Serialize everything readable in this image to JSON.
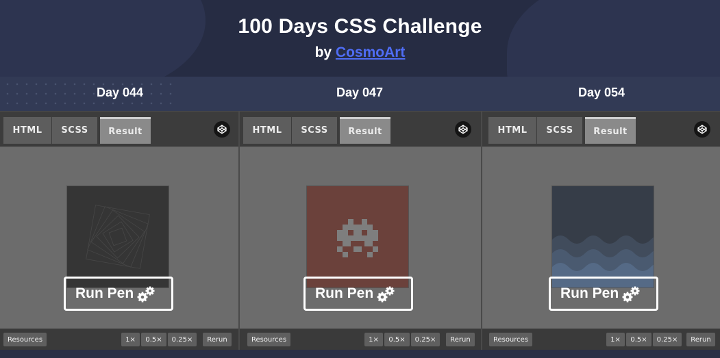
{
  "header": {
    "title": "100 Days CSS Challenge",
    "by_prefix": "by",
    "author": "CosmoArt"
  },
  "pens": [
    {
      "day": "Day 044",
      "tabs": [
        "HTML",
        "SCSS",
        "Result"
      ],
      "active_tab": "Result",
      "run_label": "Run Pen",
      "bottom": [
        "Resources",
        "1×",
        "0.5×",
        "0.25×",
        "Rerun"
      ]
    },
    {
      "day": "Day 047",
      "tabs": [
        "HTML",
        "SCSS",
        "Result"
      ],
      "active_tab": "Result",
      "run_label": "Run Pen",
      "bottom": [
        "Resources",
        "1×",
        "0.5×",
        "0.25×",
        "Rerun"
      ]
    },
    {
      "day": "Day 054",
      "tabs": [
        "HTML",
        "SCSS",
        "Result"
      ],
      "active_tab": "Result",
      "run_label": "Run Pen",
      "bottom": [
        "Resources",
        "1×",
        "0.5×",
        "0.25×",
        "Rerun"
      ]
    }
  ],
  "colors": {
    "header_bg": "#262c43",
    "strip_bg": "#323a55",
    "author_link": "#4f6df5",
    "pen_bg": "#6c6c6c",
    "day44_preview": "#353535",
    "day47_preview": "#6b413b",
    "day54_preview": "#363d48"
  },
  "icons": [
    "codepen-icon",
    "gears-icon"
  ]
}
